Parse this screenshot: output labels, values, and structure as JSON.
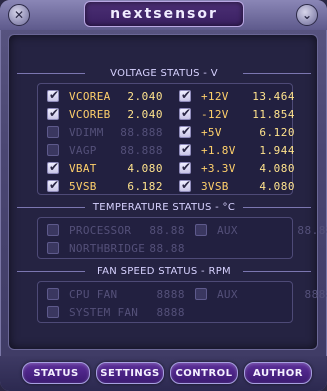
{
  "app": {
    "title": "nextsensor"
  },
  "window": {
    "close_icon": "close-icon",
    "collapse_icon": "double-chevron-down-icon"
  },
  "voltage": {
    "title": "VOLTAGE STATUS - V",
    "left": [
      {
        "label": "VCOREA",
        "value": "2.040",
        "checked": true,
        "enabled": true
      },
      {
        "label": "VCOREB",
        "value": "2.040",
        "checked": true,
        "enabled": true
      },
      {
        "label": "VDIMM",
        "value": "88.888",
        "checked": false,
        "enabled": false
      },
      {
        "label": "VAGP",
        "value": "88.888",
        "checked": false,
        "enabled": false
      },
      {
        "label": "VBAT",
        "value": "4.080",
        "checked": true,
        "enabled": true
      },
      {
        "label": "5VSB",
        "value": "6.182",
        "checked": true,
        "enabled": true
      }
    ],
    "right": [
      {
        "label": "+12V",
        "value": "13.464",
        "checked": true,
        "enabled": true
      },
      {
        "label": "-12V",
        "value": "11.854",
        "checked": true,
        "enabled": true
      },
      {
        "label": "+5V",
        "value": "6.120",
        "checked": true,
        "enabled": true
      },
      {
        "label": "+1.8V",
        "value": "1.944",
        "checked": true,
        "enabled": true
      },
      {
        "label": "+3.3V",
        "value": "4.080",
        "checked": true,
        "enabled": true
      },
      {
        "label": "3VSB",
        "value": "4.080",
        "checked": true,
        "enabled": true
      }
    ]
  },
  "temperature": {
    "title": "TEMPERATURE STATUS - °C",
    "rows": [
      {
        "label": "PROCESSOR",
        "value": "88.88",
        "checked": false,
        "enabled": false
      },
      {
        "label": "NORTHBRIDGE",
        "value": "88.88",
        "checked": false,
        "enabled": false
      },
      {
        "label": "AUX",
        "value": "88.88",
        "checked": false,
        "enabled": false
      }
    ]
  },
  "fan": {
    "title": "FAN SPEED STATUS - RPM",
    "rows": [
      {
        "label": "CPU FAN",
        "value": "8888",
        "checked": false,
        "enabled": false
      },
      {
        "label": "SYSTEM FAN",
        "value": "8888",
        "checked": false,
        "enabled": false
      },
      {
        "label": "AUX",
        "value": "8888",
        "checked": false,
        "enabled": false
      }
    ]
  },
  "tabs": [
    {
      "label": "STATUS"
    },
    {
      "label": "SETTINGS"
    },
    {
      "label": "CONTROL"
    },
    {
      "label": "AUTHOR"
    }
  ]
}
